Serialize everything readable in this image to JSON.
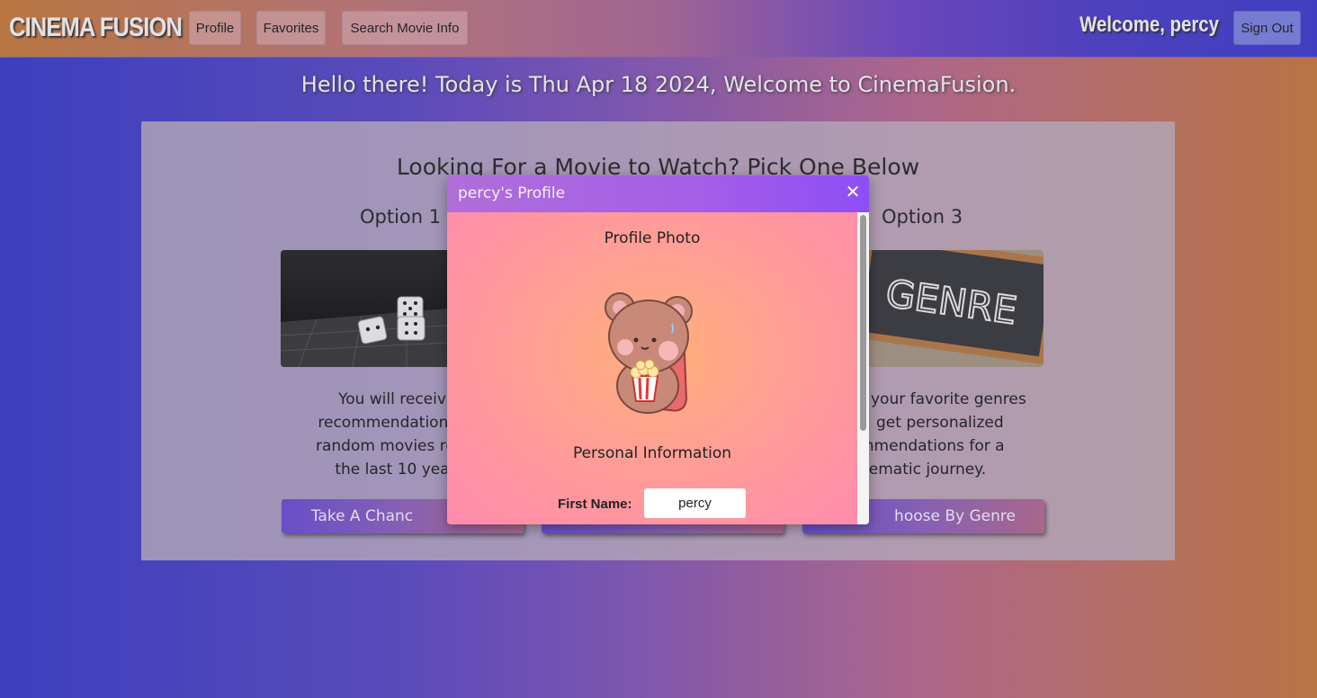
{
  "nav": {
    "brand": "CINEMA FUSION",
    "profile": "Profile",
    "favorites": "Favorites",
    "search": "Search Movie Info",
    "welcome": "Welcome, percy",
    "sign_out": "Sign Out"
  },
  "greeting": "Hello there! Today is Thu Apr 18 2024, Welcome to CinemaFusion.",
  "card": {
    "title": "Looking For a Movie to Watch? Pick One Below",
    "options": [
      {
        "title": "Option 1",
        "image_icon": "dice-icon",
        "lines": [
          "You will receiv",
          "recommendations f",
          "random movies rele",
          "the last 10 yea"
        ],
        "button": "Take A Chanc"
      },
      {
        "title": "",
        "image_icon": "",
        "lines": [],
        "button": ""
      },
      {
        "title": "Option 3",
        "image_icon": "genre-chalkboard-icon",
        "image_text": "GENRE",
        "lines": [
          "your favorite genres",
          "get personalized",
          "mmendations for a",
          "nematic journey."
        ],
        "button": "hoose By Genre"
      }
    ]
  },
  "modal": {
    "title": "percy's Profile",
    "close_icon": "close-icon",
    "photo_label": "Profile Photo",
    "photo_icon": "bear-popcorn-avatar-icon",
    "personal_label": "Personal Information",
    "first_name_label": "First Name:",
    "first_name_value": "percy"
  },
  "colors": {
    "modal_header": "#a45ee8",
    "modal_body": "#ff9e96",
    "button": "#7a55c8"
  }
}
